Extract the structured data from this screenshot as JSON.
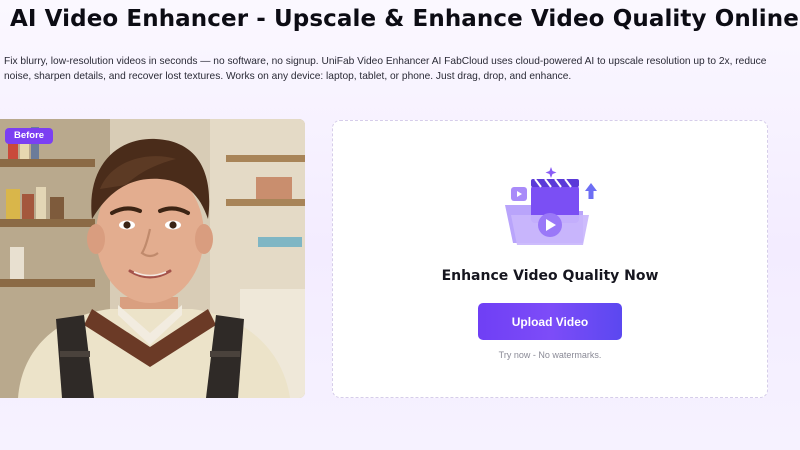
{
  "header": {
    "title": "AI Video Enhancer - Upscale & Enhance Video Quality Online",
    "description": "Fix blurry, low-resolution videos in seconds — no software, no signup. UniFab Video Enhancer AI FabCloud uses cloud-powered AI to upscale resolution up to 2x, reduce noise, sharpen details, and recover lost textures. Works on any device: laptop, tablet, or phone. Just drag, drop, and enhance."
  },
  "preview": {
    "badge": "Before"
  },
  "upload": {
    "icon": "video-folder-icon",
    "heading": "Enhance Video Quality Now",
    "button_label": "Upload Video",
    "note": "Try now - No watermarks."
  },
  "colors": {
    "accent": "#7b3ff2",
    "button_start": "#6f3ff5",
    "button_end": "#5b48f0",
    "background": "#f6f2ff"
  }
}
